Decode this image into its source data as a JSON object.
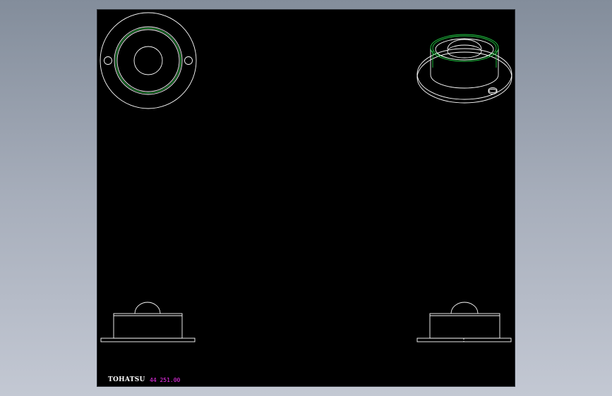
{
  "drawing": {
    "brand": "TOHATSU",
    "part_number": "44 251.00"
  },
  "colors": {
    "background": "#000000",
    "outline": "#ffffff",
    "highlight": "#22cc44",
    "annotation": "#ff33ff"
  }
}
